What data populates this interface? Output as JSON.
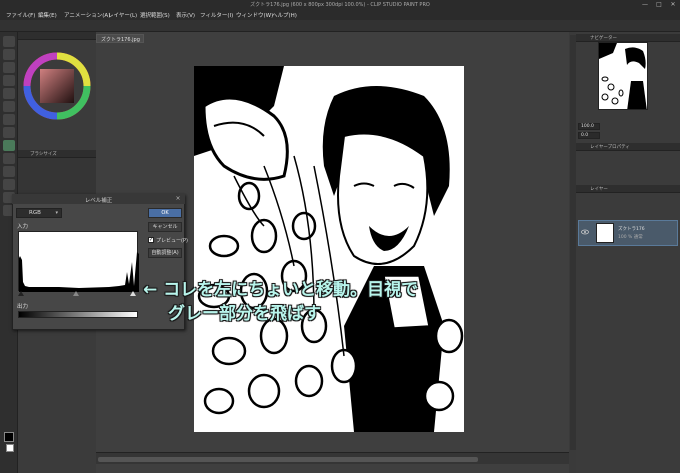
{
  "window": {
    "title": "ズクトラ176.jpg (600 x 800px 300dpi 100.0%) - CLIP STUDIO PAINT PRO",
    "minimize": "—",
    "maximize": "□",
    "close": "✕"
  },
  "menubar": {
    "items": [
      "ファイル(F)",
      "編集(E)",
      "アニメーション(A)",
      "レイヤー(L)",
      "選択範囲(S)",
      "表示(V)",
      "フィルター(I)",
      "ウィンドウ(W)",
      "ヘルプ(H)"
    ]
  },
  "document": {
    "tab_label": "ズクトラ176.jpg"
  },
  "left_panel": {
    "brush_panel_title": "ブラシサイズ"
  },
  "right_panel": {
    "navigator_title": "ナビゲーター",
    "layer_property_title": "レイヤープロパティ",
    "layer_title": "レイヤー",
    "zoom_value": "100.0",
    "rotate_value": "0.0",
    "layer_name": "ズクトラ176",
    "layer_mode": "100 % 通常"
  },
  "dialog": {
    "title": "レベル補正",
    "channel": "RGB",
    "input_label": "入力",
    "output_label": "出力",
    "ok_button": "OK",
    "cancel_button": "キャンセル",
    "preview_label": "プレビュー(P)",
    "auto_adjust_button": "自動調整(A)"
  },
  "annotation": {
    "line1": "← コレを左にちょいと移動。目視で",
    "line2": "グレー部分を飛ばす"
  },
  "colors": {
    "accent": "#4a6fa5",
    "annotation": "#b8f5ec"
  }
}
